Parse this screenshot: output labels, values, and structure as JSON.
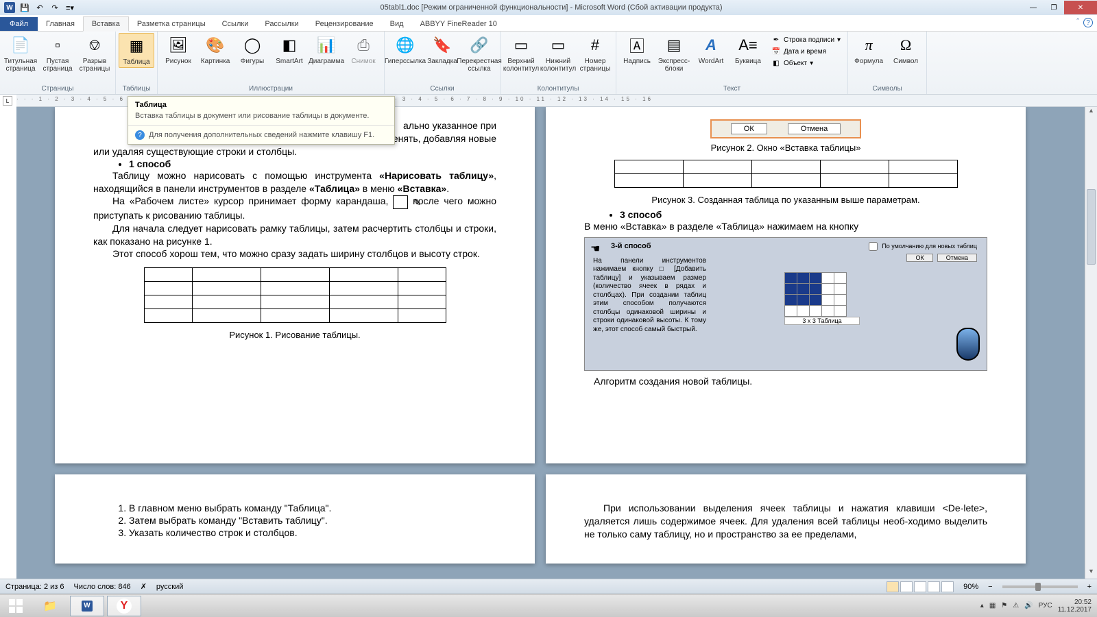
{
  "title": "05tabl1.doc [Режим ограниченной функциональности] - Microsoft Word (Сбой активации продукта)",
  "tabs": {
    "file": "Файл",
    "items": [
      "Главная",
      "Вставка",
      "Разметка страницы",
      "Ссылки",
      "Рассылки",
      "Рецензирование",
      "Вид",
      "ABBYY FineReader 10"
    ],
    "active": "Вставка"
  },
  "ribbon": {
    "groups": {
      "pages": {
        "label": "Страницы",
        "btns": [
          "Титульная страница",
          "Пустая страница",
          "Разрыв страницы"
        ]
      },
      "tables": {
        "label": "Таблицы",
        "btn": "Таблица"
      },
      "illus": {
        "label": "Иллюстрации",
        "btns": [
          "Рисунок",
          "Картинка",
          "Фигуры",
          "SmartArt",
          "Диаграмма",
          "Снимок"
        ]
      },
      "links": {
        "label": "Ссылки",
        "btns": [
          "Гиперссылка",
          "Закладка",
          "Перекрестная ссылка"
        ]
      },
      "headers": {
        "label": "Колонтитулы",
        "btns": [
          "Верхний колонтитул",
          "Нижний колонтитул",
          "Номер страницы"
        ]
      },
      "text": {
        "label": "Текст",
        "btns": [
          "Надпись",
          "Экспресс-блоки",
          "WordArt",
          "Буквица"
        ],
        "small": [
          "Строка подписи",
          "Дата и время",
          "Объект"
        ]
      },
      "symbols": {
        "label": "Символы",
        "btns": [
          "Формула",
          "Символ"
        ]
      }
    }
  },
  "tooltip": {
    "title": "Таблица",
    "body": "Вставка таблицы в документ или рисование таблицы в документе.",
    "footer": "Для получения дополнительных сведений нажмите клавишу F1."
  },
  "doc": {
    "p1": {
      "l1_tail": "ально указанное при",
      "l2_tail": "енять, добавляя новые",
      "l3": "или удаляя существующие строки и столбцы.",
      "bullet1": "1 способ",
      "para1a": "Таблицу можно нарисовать с помощью инструмента ",
      "para1b": "«Нарисовать таблицу»",
      "para1c": ", находящийся в панели инструментов в разделе ",
      "para1d": "«Таблица»",
      "para1e": " в меню ",
      "para1f": "«Вставка»",
      "para1g": ".",
      "para2a": "На «Рабочем листе» курсор принимает форму карандаша, ",
      "para2b": " после чего можно приступать  к рисованию таблицы.",
      "para3": "Для начала следует нарисовать рамку таблицы, затем расчертить столбцы и строки, как показано на рисунке 1.",
      "para4": "Этот способ хорош тем, что можно сразу задать ширину столбцов и высоту строк.",
      "fig1": "Рисунок 1. Рисование таблицы."
    },
    "p2": {
      "dlg_ok": "ОК",
      "dlg_cancel": "Отмена",
      "fig2": "Рисунок 2. Окно «Вставка таблицы»",
      "fig3": "Рисунок 3. Созданная таблица по указанным выше параметрам.",
      "bullet3": "3 способ",
      "para3": "В меню «Вставка» в разделе «Таблица» нажимаем на кнопку",
      "embed_title": "3-й способ",
      "embed_text": "На панели инструментов нажимаем кнопку □ [Добавить таблицу] и указываем размер (количество ячеек в рядах и столбцах). При создании таблиц этим способом получаются столбцы одинаковой ширины и строки одинаковой высоты. К тому же, этот способ самый быстрый.",
      "grid_label": "3 x 3 Таблица",
      "chk": "По умолчанию для новых таблиц",
      "ok": "ОК",
      "cancel": "Отмена",
      "algo": "Алгоритм создания новой таблицы."
    },
    "p3": {
      "items": [
        "В главном меню выбрать команду \"Таблица\".",
        "Затем выбрать команду \"Вставить таблицу\".",
        "Указать количество строк и столбцов."
      ]
    },
    "p4": {
      "para": "При использовании выделения ячеек таблицы и нажатия клавиши <De-lete>, удаляется лишь содержимое ячеек. Для удаления всей таблицы необ-ходимо выделить не только саму таблицу, но и пространство за ее пределами,"
    }
  },
  "status": {
    "page": "Страница: 2 из 6",
    "words": "Число слов: 846",
    "lang": "русский",
    "zoom": "90%"
  },
  "tray": {
    "lang": "РУС",
    "time": "20:52",
    "date": "11.12.2017"
  }
}
